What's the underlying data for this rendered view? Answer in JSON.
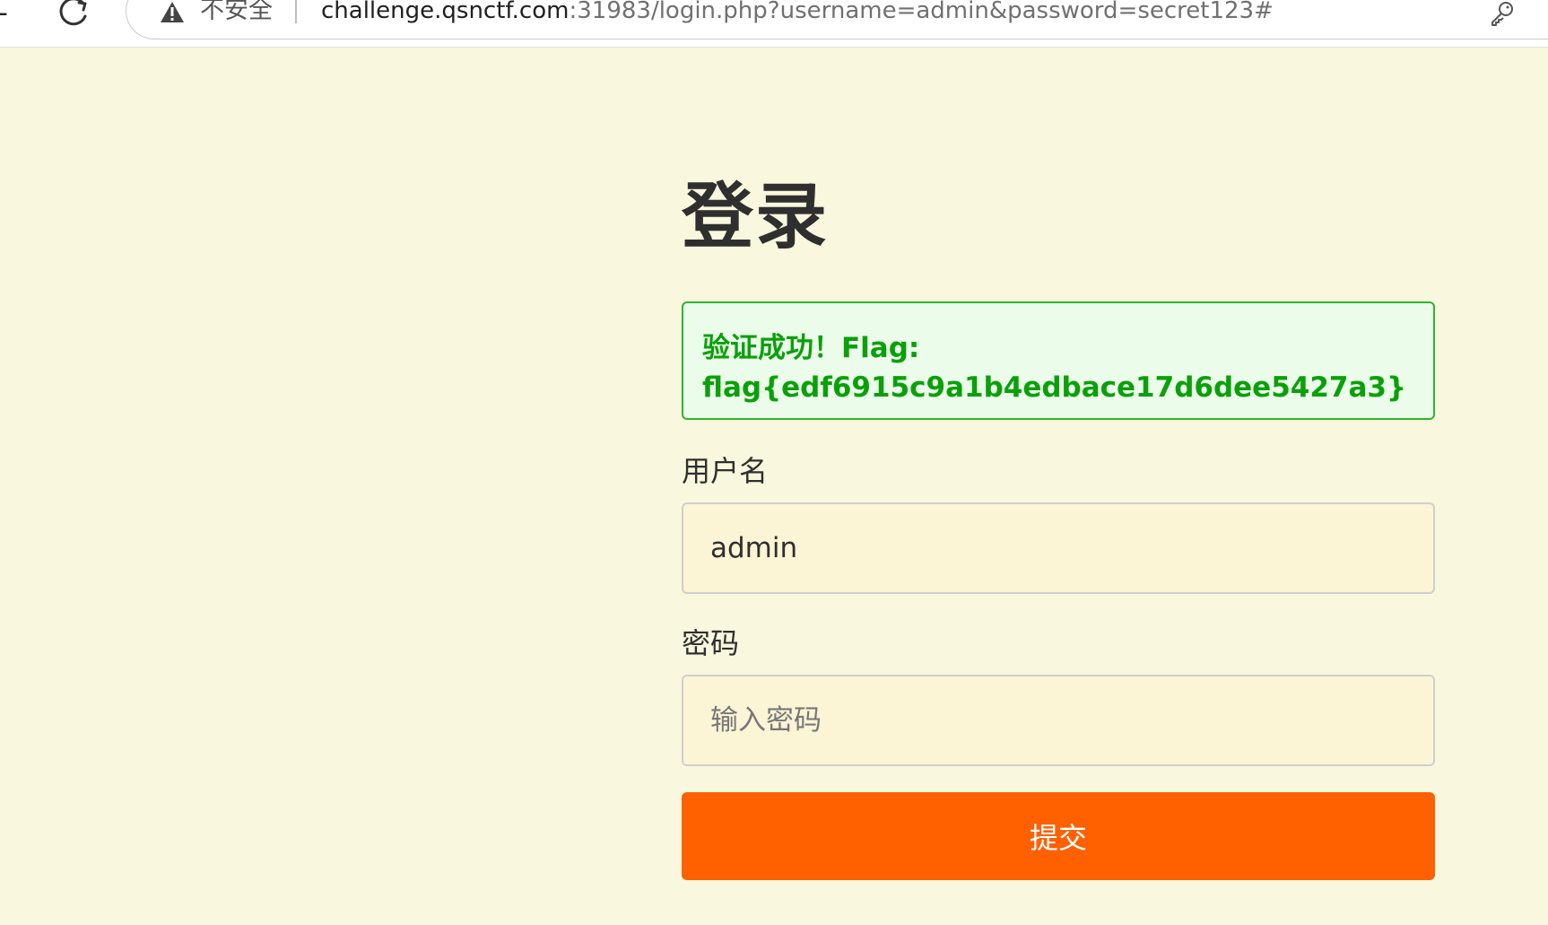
{
  "browser": {
    "back_fragment": "-",
    "security_label": "不安全",
    "url_host": "challenge.qsnctf.com",
    "url_path": ":31983/login.php?username=admin&password=secret123#"
  },
  "page": {
    "title": "登录",
    "alert": {
      "line1": "验证成功！Flag:",
      "line2": "flag{edf6915c9a1b4edbace17d6dee5427a3}"
    },
    "username_label": "用户名",
    "username_value": "admin",
    "password_label": "密码",
    "password_placeholder": "输入密码",
    "submit_label": "提交"
  },
  "colors": {
    "page_background": "#f9f7dd",
    "success_text": "#0aa00a",
    "success_background": "#ecfcea",
    "button_background": "#ff6000"
  },
  "icons": {
    "reload": "reload-icon",
    "security": "warning-icon",
    "password_manager": "key-icon"
  }
}
